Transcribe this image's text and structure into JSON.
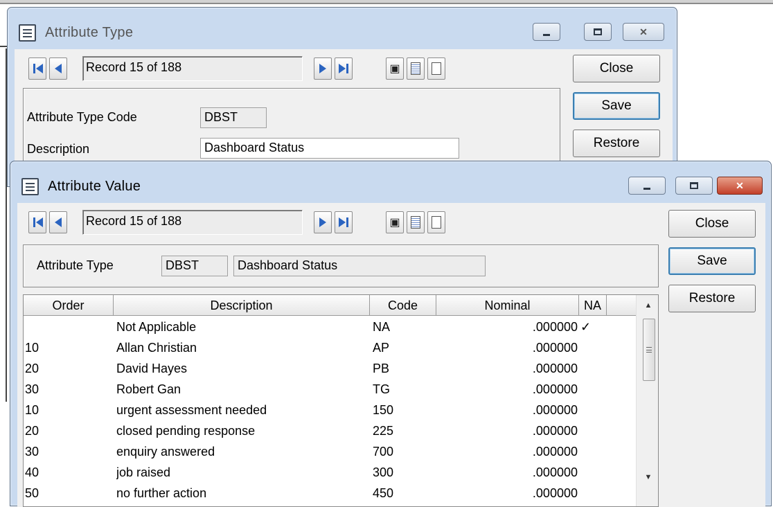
{
  "back_window": {
    "title": "Attribute Type",
    "record_text": "Record 15 of 188",
    "buttons": {
      "close": "Close",
      "save": "Save",
      "restore": "Restore"
    },
    "fields": {
      "code_label": "Attribute Type Code",
      "code_value": "DBST",
      "description_label": "Description",
      "description_value": "Dashboard Status"
    }
  },
  "front_window": {
    "title": "Attribute Value",
    "record_text": "Record 15 of 188",
    "buttons": {
      "close": "Close",
      "save": "Save",
      "restore": "Restore"
    },
    "attribute_type": {
      "label": "Attribute Type",
      "code": "DBST",
      "description": "Dashboard Status"
    },
    "grid": {
      "columns": [
        "Order",
        "Description",
        "Code",
        "Nominal",
        "NA"
      ],
      "rows": [
        {
          "order": "",
          "description": "Not Applicable",
          "code": "NA",
          "nominal": ".000000",
          "na": "✓"
        },
        {
          "order": "10",
          "description": "Allan Christian",
          "code": "AP",
          "nominal": ".000000",
          "na": ""
        },
        {
          "order": "20",
          "description": "David Hayes",
          "code": "PB",
          "nominal": ".000000",
          "na": ""
        },
        {
          "order": "30",
          "description": "Robert Gan",
          "code": "TG",
          "nominal": ".000000",
          "na": ""
        },
        {
          "order": "10",
          "description": "urgent assessment needed",
          "code": "150",
          "nominal": ".000000",
          "na": ""
        },
        {
          "order": "20",
          "description": "closed pending response",
          "code": "225",
          "nominal": ".000000",
          "na": ""
        },
        {
          "order": "30",
          "description": "enquiry answered",
          "code": "700",
          "nominal": ".000000",
          "na": ""
        },
        {
          "order": "40",
          "description": "job raised",
          "code": "300",
          "nominal": ".000000",
          "na": ""
        },
        {
          "order": "50",
          "description": "no further action",
          "code": "450",
          "nominal": ".000000",
          "na": ""
        }
      ]
    }
  },
  "icons": [
    "window-menu-icon",
    "first-record-icon",
    "previous-record-icon",
    "next-record-icon",
    "last-record-icon",
    "find-binoculars-icon",
    "list-view-icon",
    "new-record-icon",
    "minimize-icon",
    "maximize-icon",
    "close-icon",
    "scroll-up-icon",
    "scroll-down-icon"
  ],
  "colors": {
    "title_bar": "#c9daef",
    "client_area": "#f0f0f0",
    "nav_arrow": "#2b64c0",
    "close_red": "#c3402a"
  }
}
